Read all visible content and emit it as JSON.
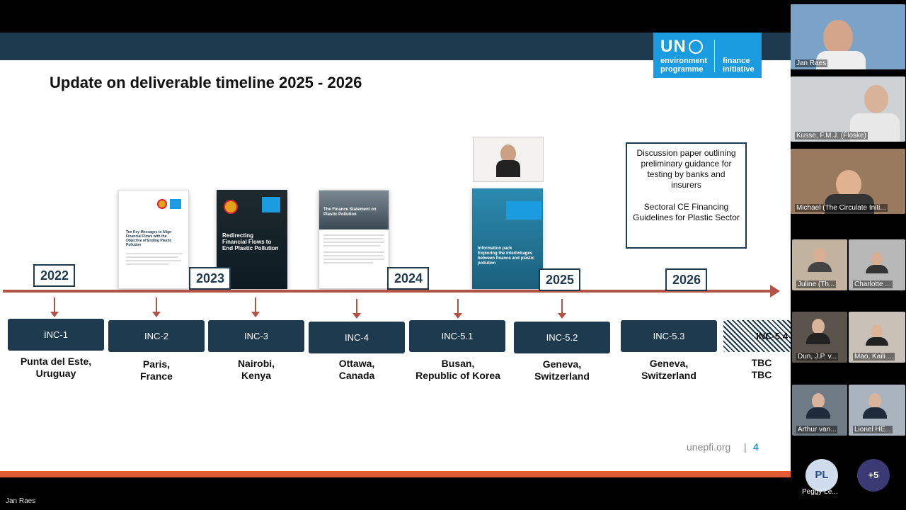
{
  "slide": {
    "title": "Update on deliverable timeline 2025 - 2026",
    "logo": {
      "un": "UN",
      "env": "environment programme",
      "finance": "finance initiative"
    },
    "years": [
      "2022",
      "2023",
      "2024",
      "2025",
      "2026"
    ],
    "incs": [
      {
        "label": "INC-1",
        "loc": "Punta del Este,\nUruguay"
      },
      {
        "label": "INC-2",
        "loc": "Paris,\nFrance"
      },
      {
        "label": "INC-3",
        "loc": "Nairobi,\nKenya"
      },
      {
        "label": "INC-4",
        "loc": "Ottawa,\nCanada"
      },
      {
        "label": "INC-5.1",
        "loc": "Busan,\nRepublic of Korea"
      },
      {
        "label": "INC-5.2",
        "loc": "Geneva,\nSwitzerland"
      },
      {
        "label": "INC-5.3",
        "loc": "Geneva,\nSwitzerland"
      },
      {
        "label": "INC-5.4",
        "loc": "TBC\nTBC"
      }
    ],
    "docs": {
      "doc1_title": "Ten Key Messages to Align Financial Flows with the Objective of Ending Plastic Pollution",
      "doc2_title": "Redirecting Financial Flows to End Plastic Pollution",
      "doc3_title": "The Finance Statement on Plastic Pollution",
      "doc4_title": "Information pack\nExploring the interlinkages between finance and plastic pollution"
    },
    "info_box": {
      "line1": "Discussion paper outlining preliminary guidance for testing by banks and insurers",
      "line2": "Sectoral CE Financing Guidelines for Plastic Sector"
    },
    "footer": {
      "link": "unepfi.org",
      "sep": "|",
      "page": "4"
    }
  },
  "presenter_label": "Jan Raes",
  "participants": [
    {
      "name": "Jan Raes"
    },
    {
      "name": "Kusse, F.M.J. (Floske)"
    },
    {
      "name": "Michael (The Circulate Initi..."
    },
    {
      "name": "Juline (Th..."
    },
    {
      "name": "Charlotte ..."
    },
    {
      "name": "Dun, J.P. v..."
    },
    {
      "name": "Mao, Kaili ..."
    },
    {
      "name": "Arthur van..."
    },
    {
      "name": "Lionel HE..."
    }
  ],
  "avatars": {
    "pl_initials": "PL",
    "pl_name": "Peggy Le...",
    "more": "+5"
  }
}
